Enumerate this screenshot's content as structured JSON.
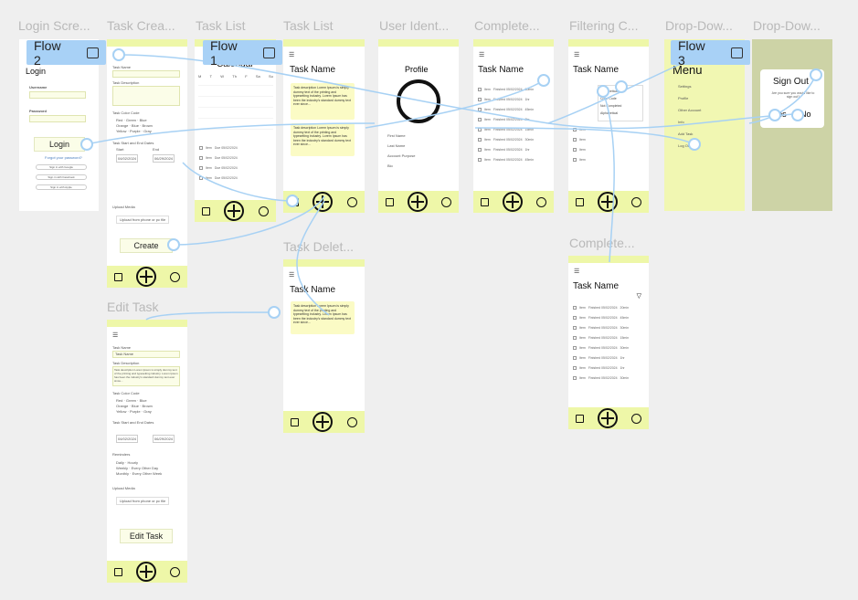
{
  "frames": [
    {
      "id": "login",
      "title": "Login Scre..."
    },
    {
      "id": "task_create",
      "title": "Task Crea..."
    },
    {
      "id": "task_list_cal",
      "title": "Task List"
    },
    {
      "id": "task_list",
      "title": "Task List"
    },
    {
      "id": "user_ident",
      "title": "User Ident..."
    },
    {
      "id": "completed",
      "title": "Complete..."
    },
    {
      "id": "filtering",
      "title": "Filtering C..."
    },
    {
      "id": "dropdown1",
      "title": "Drop-Dow..."
    },
    {
      "id": "dropdown2",
      "title": "Drop-Dow..."
    },
    {
      "id": "task_delete",
      "title": "Task Delet..."
    },
    {
      "id": "completed2",
      "title": "Complete..."
    },
    {
      "id": "edit_task",
      "title": "Edit Task"
    }
  ],
  "flows": [
    "Flow 2",
    "Flow 1",
    "Flow 3"
  ],
  "login": {
    "heading": "Login",
    "username_label": "Username",
    "password_label": "Password",
    "button": "Login",
    "forgot": "Forgot your password?",
    "social": [
      "Sign in with Google",
      "Sign in with Facebook",
      "Sign in with Apple"
    ]
  },
  "task_create": {
    "name_label": "Task Name",
    "desc_label": "Task Description",
    "color_label": "Task Color Code",
    "colors": [
      "Red",
      "Green",
      "Blue",
      "Orange",
      "Blue",
      "Brown",
      "Yellow",
      "Purple",
      "Gray"
    ],
    "start_end_label": "Task Start and End Dates",
    "start": "Start",
    "end": "End",
    "start_date": "04/02/2024",
    "end_date": "06/29/2024",
    "upload_label": "Upload Media",
    "upload": "Upload from phone or pc file",
    "button": "Create"
  },
  "calendar": {
    "title": "Calendar",
    "days": [
      "M",
      "T",
      "W",
      "Th",
      "F",
      "Sa",
      "Su"
    ]
  },
  "task_list": {
    "title": "Task Name",
    "desc": "Task description Lorem Ipsum is simply dummy text of the printing and typesetting industry. Lorem Ipsum has been the industry's standard dummy text ever since...",
    "item": "Item",
    "due": "Due 05/02/2024"
  },
  "user_ident": {
    "title": "Profile",
    "fields": [
      "First Name",
      "Last Name",
      "Account Purpose",
      "Bio"
    ]
  },
  "completed": {
    "title": "Task Name",
    "item": "Item",
    "finished": "Finished 05/02/2024",
    "times": [
      "30min",
      "1hr",
      "45min",
      "2hr",
      "15min",
      "30min",
      "1hr",
      "45min",
      "30min",
      "1hr"
    ]
  },
  "filtering": {
    "title": "Task Name",
    "menu": [
      "Alphabetical",
      "Color Code",
      "Not Completed",
      "Alphabetical"
    ]
  },
  "dropdown": {
    "title": "Menu",
    "items": [
      "Settings",
      "Profile",
      "Other Account",
      "Info",
      "Add Task",
      "Log Out"
    ]
  },
  "signout": {
    "title": "Sign Out",
    "message": "Are you sure you would like to sign out?",
    "yes": "Yes",
    "no": "No"
  },
  "task_delete": {
    "title": "Task Name"
  },
  "completed2": {
    "title": "Task Name",
    "times": [
      "20min",
      "45min",
      "30min",
      "15min",
      "30min",
      "1hr",
      "1hr",
      "30min",
      "15min",
      "12min"
    ]
  },
  "edit_task": {
    "name_label": "Task Name",
    "name_value": "Task Name",
    "desc_label": "Task Description",
    "color_label": "Task Color Code",
    "start_end_label": "Task Start and End Dates",
    "reminder_label": "Reminders",
    "reminders": [
      "Daily",
      "Hourly",
      "Weekly",
      "Every Other Day",
      "Monthly",
      "Every Other Week"
    ],
    "upload_label": "Upload Media",
    "upload": "Upload from phone or pc file",
    "button": "Edit Task"
  },
  "colors": {
    "accent": "#eef7a8",
    "wire": "#a7d1f4",
    "flow": "#a8d1f6"
  }
}
